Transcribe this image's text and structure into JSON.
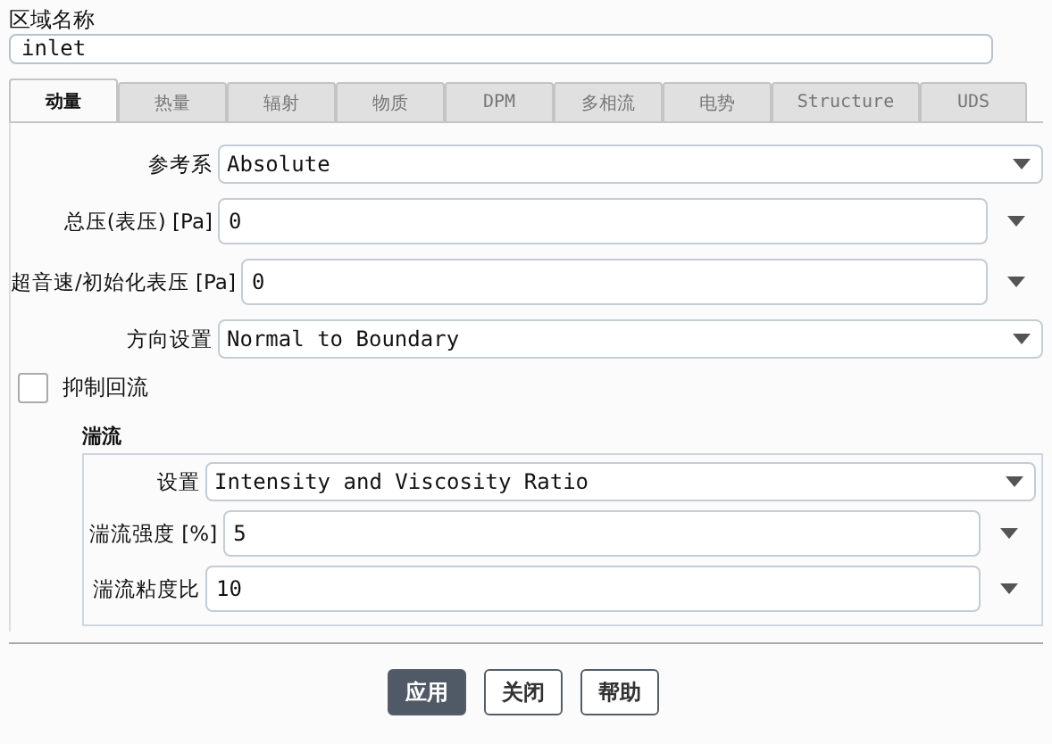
{
  "zone_name": {
    "label": "区域名称",
    "value": "inlet"
  },
  "tabs": [
    {
      "label": "动量",
      "selected": true
    },
    {
      "label": "热量",
      "selected": false
    },
    {
      "label": "辐射",
      "selected": false
    },
    {
      "label": "物质",
      "selected": false
    },
    {
      "label": "DPM",
      "selected": false
    },
    {
      "label": "多相流",
      "selected": false
    },
    {
      "label": "电势",
      "selected": false
    },
    {
      "label": "Structure",
      "selected": false
    },
    {
      "label": "UDS",
      "selected": false
    }
  ],
  "fields": [
    {
      "kind": "dropdown",
      "label": "参考系",
      "value": "Absolute"
    },
    {
      "kind": "number",
      "label": "总压(表压) [Pa]",
      "value": "0"
    },
    {
      "kind": "number",
      "label": "超音速/初始化表压 [Pa]",
      "value": "0"
    },
    {
      "kind": "dropdown",
      "label": "方向设置",
      "value": "Normal to Boundary"
    }
  ],
  "backflow": {
    "label": "抑制回流",
    "checked": false
  },
  "turbulence": {
    "title": "湍流",
    "fields": [
      {
        "kind": "dropdown",
        "label": "设置",
        "value": "Intensity and Viscosity Ratio"
      },
      {
        "kind": "number",
        "label": "湍流强度 [%]",
        "value": "5"
      },
      {
        "kind": "number",
        "label": "湍流粘度比",
        "value": "10"
      }
    ]
  },
  "buttons": [
    {
      "label": "应用",
      "primary": true
    },
    {
      "label": "关闭",
      "primary": false
    },
    {
      "label": "帮助",
      "primary": false
    }
  ]
}
